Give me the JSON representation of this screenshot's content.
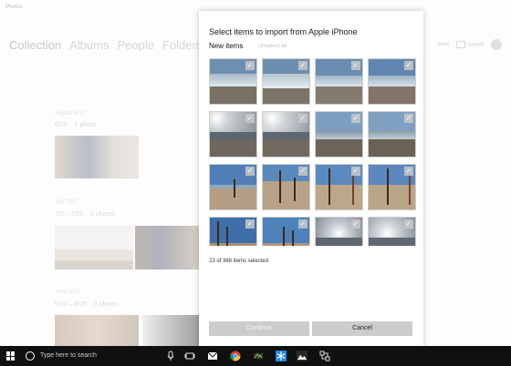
{
  "app": {
    "title": "Photos",
    "nav": [
      "Collection",
      "Albums",
      "People",
      "Folders"
    ],
    "actions": {
      "select": "elect",
      "import": "Import"
    }
  },
  "groups": [
    {
      "month": "August 2017",
      "range": "8/25",
      "count": "1 photo"
    },
    {
      "month": "July 2017",
      "range": "7/3 – 7/26",
      "count": "2 photos"
    },
    {
      "month": "June 2017",
      "range": "6/10 – 6/23",
      "count": "3 photos"
    }
  ],
  "dialog": {
    "title": "Select items to import from Apple iPhone",
    "new_items": "New items",
    "unselect_all": "Unselect all",
    "selected_count": "23 of 368 items selected",
    "continue_label": "Continue",
    "cancel_label": "Cancel"
  },
  "taskbar": {
    "search_placeholder": "Type here to search",
    "icons": [
      "microphone-icon",
      "task-view-icon",
      "mail-icon",
      "chrome-icon",
      "app-icon",
      "snowflake-icon",
      "photos-icon",
      "network-icon"
    ]
  }
}
